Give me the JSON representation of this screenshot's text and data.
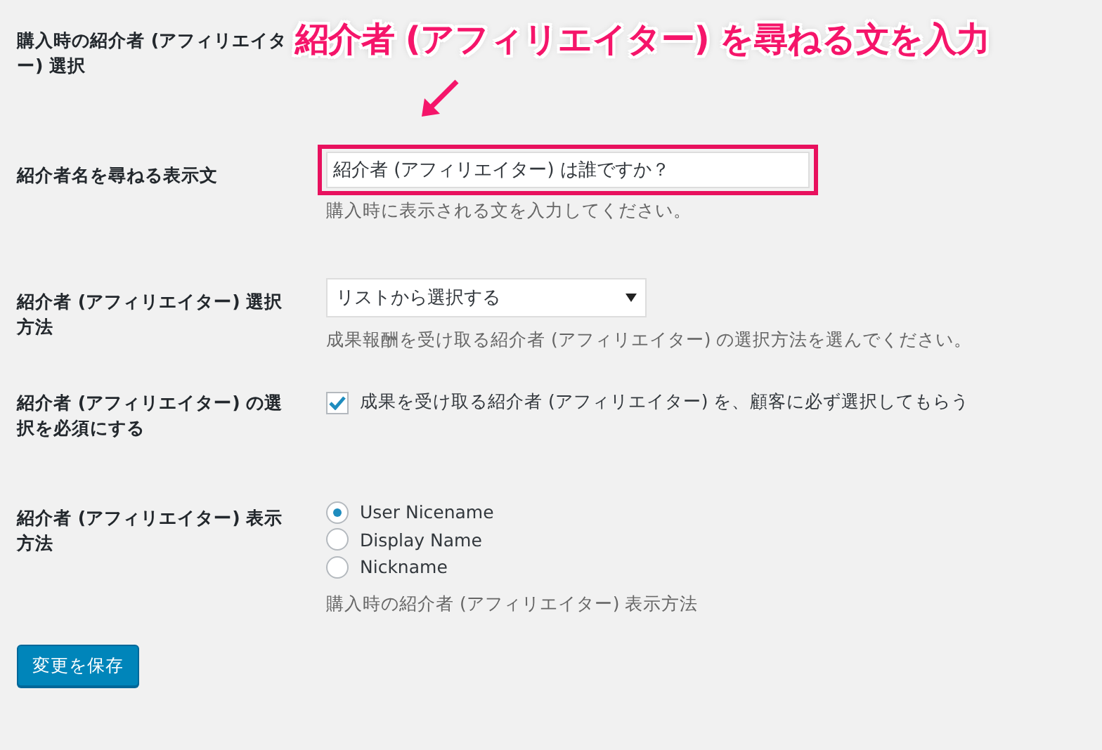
{
  "settings": [
    {
      "label": "購入時の紹介者 (アフィリエイター) 選択",
      "kind": "none"
    },
    {
      "label": "紹介者名を尋ねる表示文",
      "kind": "text",
      "value": "紹介者 (アフィリエイター) は誰ですか？",
      "highlighted": true,
      "description": "購入時に表示される文を入力してください。"
    },
    {
      "label": "紹介者 (アフィリエイター) 選択方法",
      "kind": "select",
      "value": "リストから選択する",
      "description": "成果報酬を受け取る紹介者 (アフィリエイター) の選択方法を選んでください。"
    },
    {
      "label": "紹介者 (アフィリエイター) の選択を必須にする",
      "kind": "checkbox",
      "checked": true,
      "text": "成果を受け取る紹介者 (アフィリエイター) を、顧客に必ず選択してもらう"
    },
    {
      "label": "紹介者 (アフィリエイター) 表示方法",
      "kind": "radio",
      "options": [
        {
          "label": "User Nicename",
          "selected": true
        },
        {
          "label": "Display Name",
          "selected": false
        },
        {
          "label": "Nickname",
          "selected": false
        }
      ],
      "description": "購入時の紹介者 (アフィリエイター) 表示方法"
    }
  ],
  "save_button": "変更を保存",
  "annotation": {
    "text": "紹介者 (アフィリエイター) を尋ねる文を入力"
  }
}
